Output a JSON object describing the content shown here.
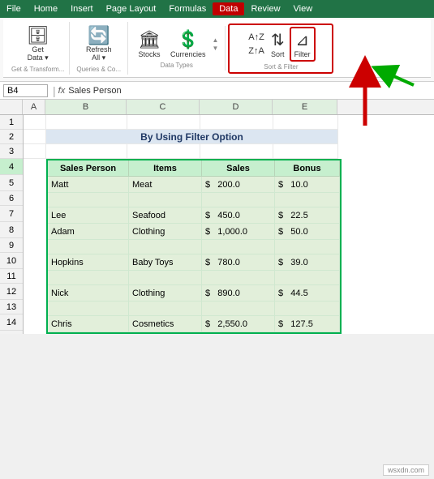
{
  "menubar": {
    "items": [
      "File",
      "Home",
      "Insert",
      "Page Layout",
      "Formulas",
      "Data",
      "Review",
      "View"
    ],
    "active": "Data"
  },
  "ribbon": {
    "groups": [
      {
        "label": "Get & Transform...",
        "buttons": [
          {
            "id": "get-data",
            "label": "Get\nData",
            "icon": "🗄"
          }
        ]
      },
      {
        "label": "Queries & Co...",
        "buttons": [
          {
            "id": "refresh",
            "label": "Refresh\nAll",
            "icon": "🔄"
          }
        ]
      },
      {
        "label": "Data Types",
        "buttons": [
          {
            "id": "stocks",
            "label": "Stocks",
            "icon": "🏛"
          },
          {
            "id": "currencies",
            "label": "Currencies",
            "icon": "💱"
          }
        ]
      },
      {
        "label": "Sort & Filter",
        "buttons": [
          {
            "id": "sort-az",
            "label": "A→Z",
            "icon": "↑"
          },
          {
            "id": "sort-za",
            "label": "Z→A",
            "icon": "↓"
          },
          {
            "id": "sort",
            "label": "Sort",
            "icon": "⇅"
          },
          {
            "id": "filter",
            "label": "Filter",
            "icon": "▽"
          }
        ]
      }
    ]
  },
  "formulabar": {
    "namebox": "B4",
    "formula": "Sales Person"
  },
  "title": "By Using Filter Option",
  "columns": [
    "",
    "A",
    "B",
    "C",
    "D",
    "E"
  ],
  "headers": [
    "Sales Person",
    "Items",
    "Sales",
    "Bonus"
  ],
  "rows": [
    {
      "num": 1,
      "cells": [
        "",
        "",
        "",
        "",
        ""
      ]
    },
    {
      "num": 2,
      "cells": [
        "",
        "title",
        "",
        "",
        ""
      ]
    },
    {
      "num": 3,
      "cells": [
        "",
        "",
        "",
        "",
        ""
      ]
    },
    {
      "num": 4,
      "cells": [
        "header",
        "Sales Person",
        "Items",
        "Sales",
        "Bonus"
      ]
    },
    {
      "num": 5,
      "cells": [
        "",
        "Matt",
        "Meat",
        "$ 200.0",
        "$ 10.0"
      ]
    },
    {
      "num": 6,
      "cells": [
        "",
        "",
        "",
        "",
        ""
      ]
    },
    {
      "num": 7,
      "cells": [
        "",
        "Lee",
        "Seafood",
        "$ 450.0",
        "$ 22.5"
      ]
    },
    {
      "num": 8,
      "cells": [
        "",
        "Adam",
        "Clothing",
        "$ 1,000.0",
        "$ 50.0"
      ]
    },
    {
      "num": 9,
      "cells": [
        "",
        "",
        "",
        "",
        ""
      ]
    },
    {
      "num": 10,
      "cells": [
        "",
        "Hopkins",
        "Baby Toys",
        "$ 780.0",
        "$ 39.0"
      ]
    },
    {
      "num": 11,
      "cells": [
        "",
        "",
        "",
        "",
        ""
      ]
    },
    {
      "num": 12,
      "cells": [
        "",
        "Nick",
        "Clothing",
        "$ 890.0",
        "$ 44.5"
      ]
    },
    {
      "num": 13,
      "cells": [
        "",
        "",
        "",
        "",
        ""
      ]
    },
    {
      "num": 14,
      "cells": [
        "",
        "Chris",
        "Cosmetics",
        "$ 2,550.0",
        "$ 127.5"
      ]
    }
  ],
  "watermark": "wsxdn.com"
}
